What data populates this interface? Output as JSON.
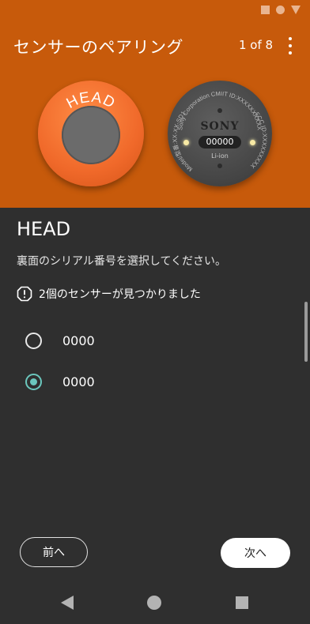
{
  "header": {
    "title": "センサーのペアリング",
    "pager": "1 of 8",
    "background": "#c75a0b"
  },
  "sensor_front": {
    "label": "HEAD",
    "color": "#f0692a"
  },
  "sensor_back": {
    "brand": "SONY",
    "serial": "00000",
    "battery": "Li-ion",
    "ring_top": "Sony Corporation  CMIIT ID:XXXXXXXXXX",
    "ring_left": "Model/型番:XX-XX-SD15",
    "ring_right": "FCC ID:XXXXXXXXX"
  },
  "main": {
    "position_label": "HEAD",
    "instruction": "裏面のシリアル番号を選択してください。",
    "notice": "2個のセンサーが見つかりました",
    "options": [
      {
        "label": "0000",
        "selected": false
      },
      {
        "label": "0000",
        "selected": true
      }
    ],
    "accent": "#6bc7bd"
  },
  "footer": {
    "back_label": "前へ",
    "next_label": "次へ"
  },
  "icons": {
    "status": [
      "stop-square-icon",
      "record-circle-icon",
      "signal-triangle-icon"
    ],
    "menu": "more-vert-icon",
    "notice": "alert-icon",
    "nav": [
      "nav-back-icon",
      "nav-home-icon",
      "nav-recents-icon"
    ]
  }
}
